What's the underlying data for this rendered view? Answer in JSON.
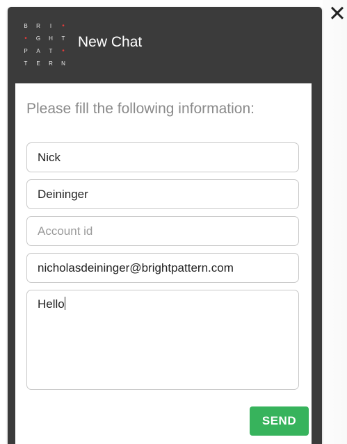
{
  "header": {
    "title": "New Chat",
    "logo_rows": [
      [
        "B",
        "R",
        "I",
        "•"
      ],
      [
        "•",
        "G",
        "H",
        "T"
      ],
      [
        "P",
        "A",
        "T",
        "•"
      ],
      [
        "T",
        "E",
        "R",
        "N"
      ]
    ]
  },
  "form": {
    "prompt": "Please fill the following information:",
    "first_name": "Nick",
    "last_name": "Deininger",
    "account_id_placeholder": "Account id",
    "email": "nicholasdeininger@brightpattern.com",
    "message": "Hello",
    "send_label": "SEND"
  },
  "window": {
    "close_glyph": "✕"
  },
  "colors": {
    "header_bg": "#3b3b3b",
    "send_green": "#37b35c",
    "logo_red": "#e23b3b"
  }
}
